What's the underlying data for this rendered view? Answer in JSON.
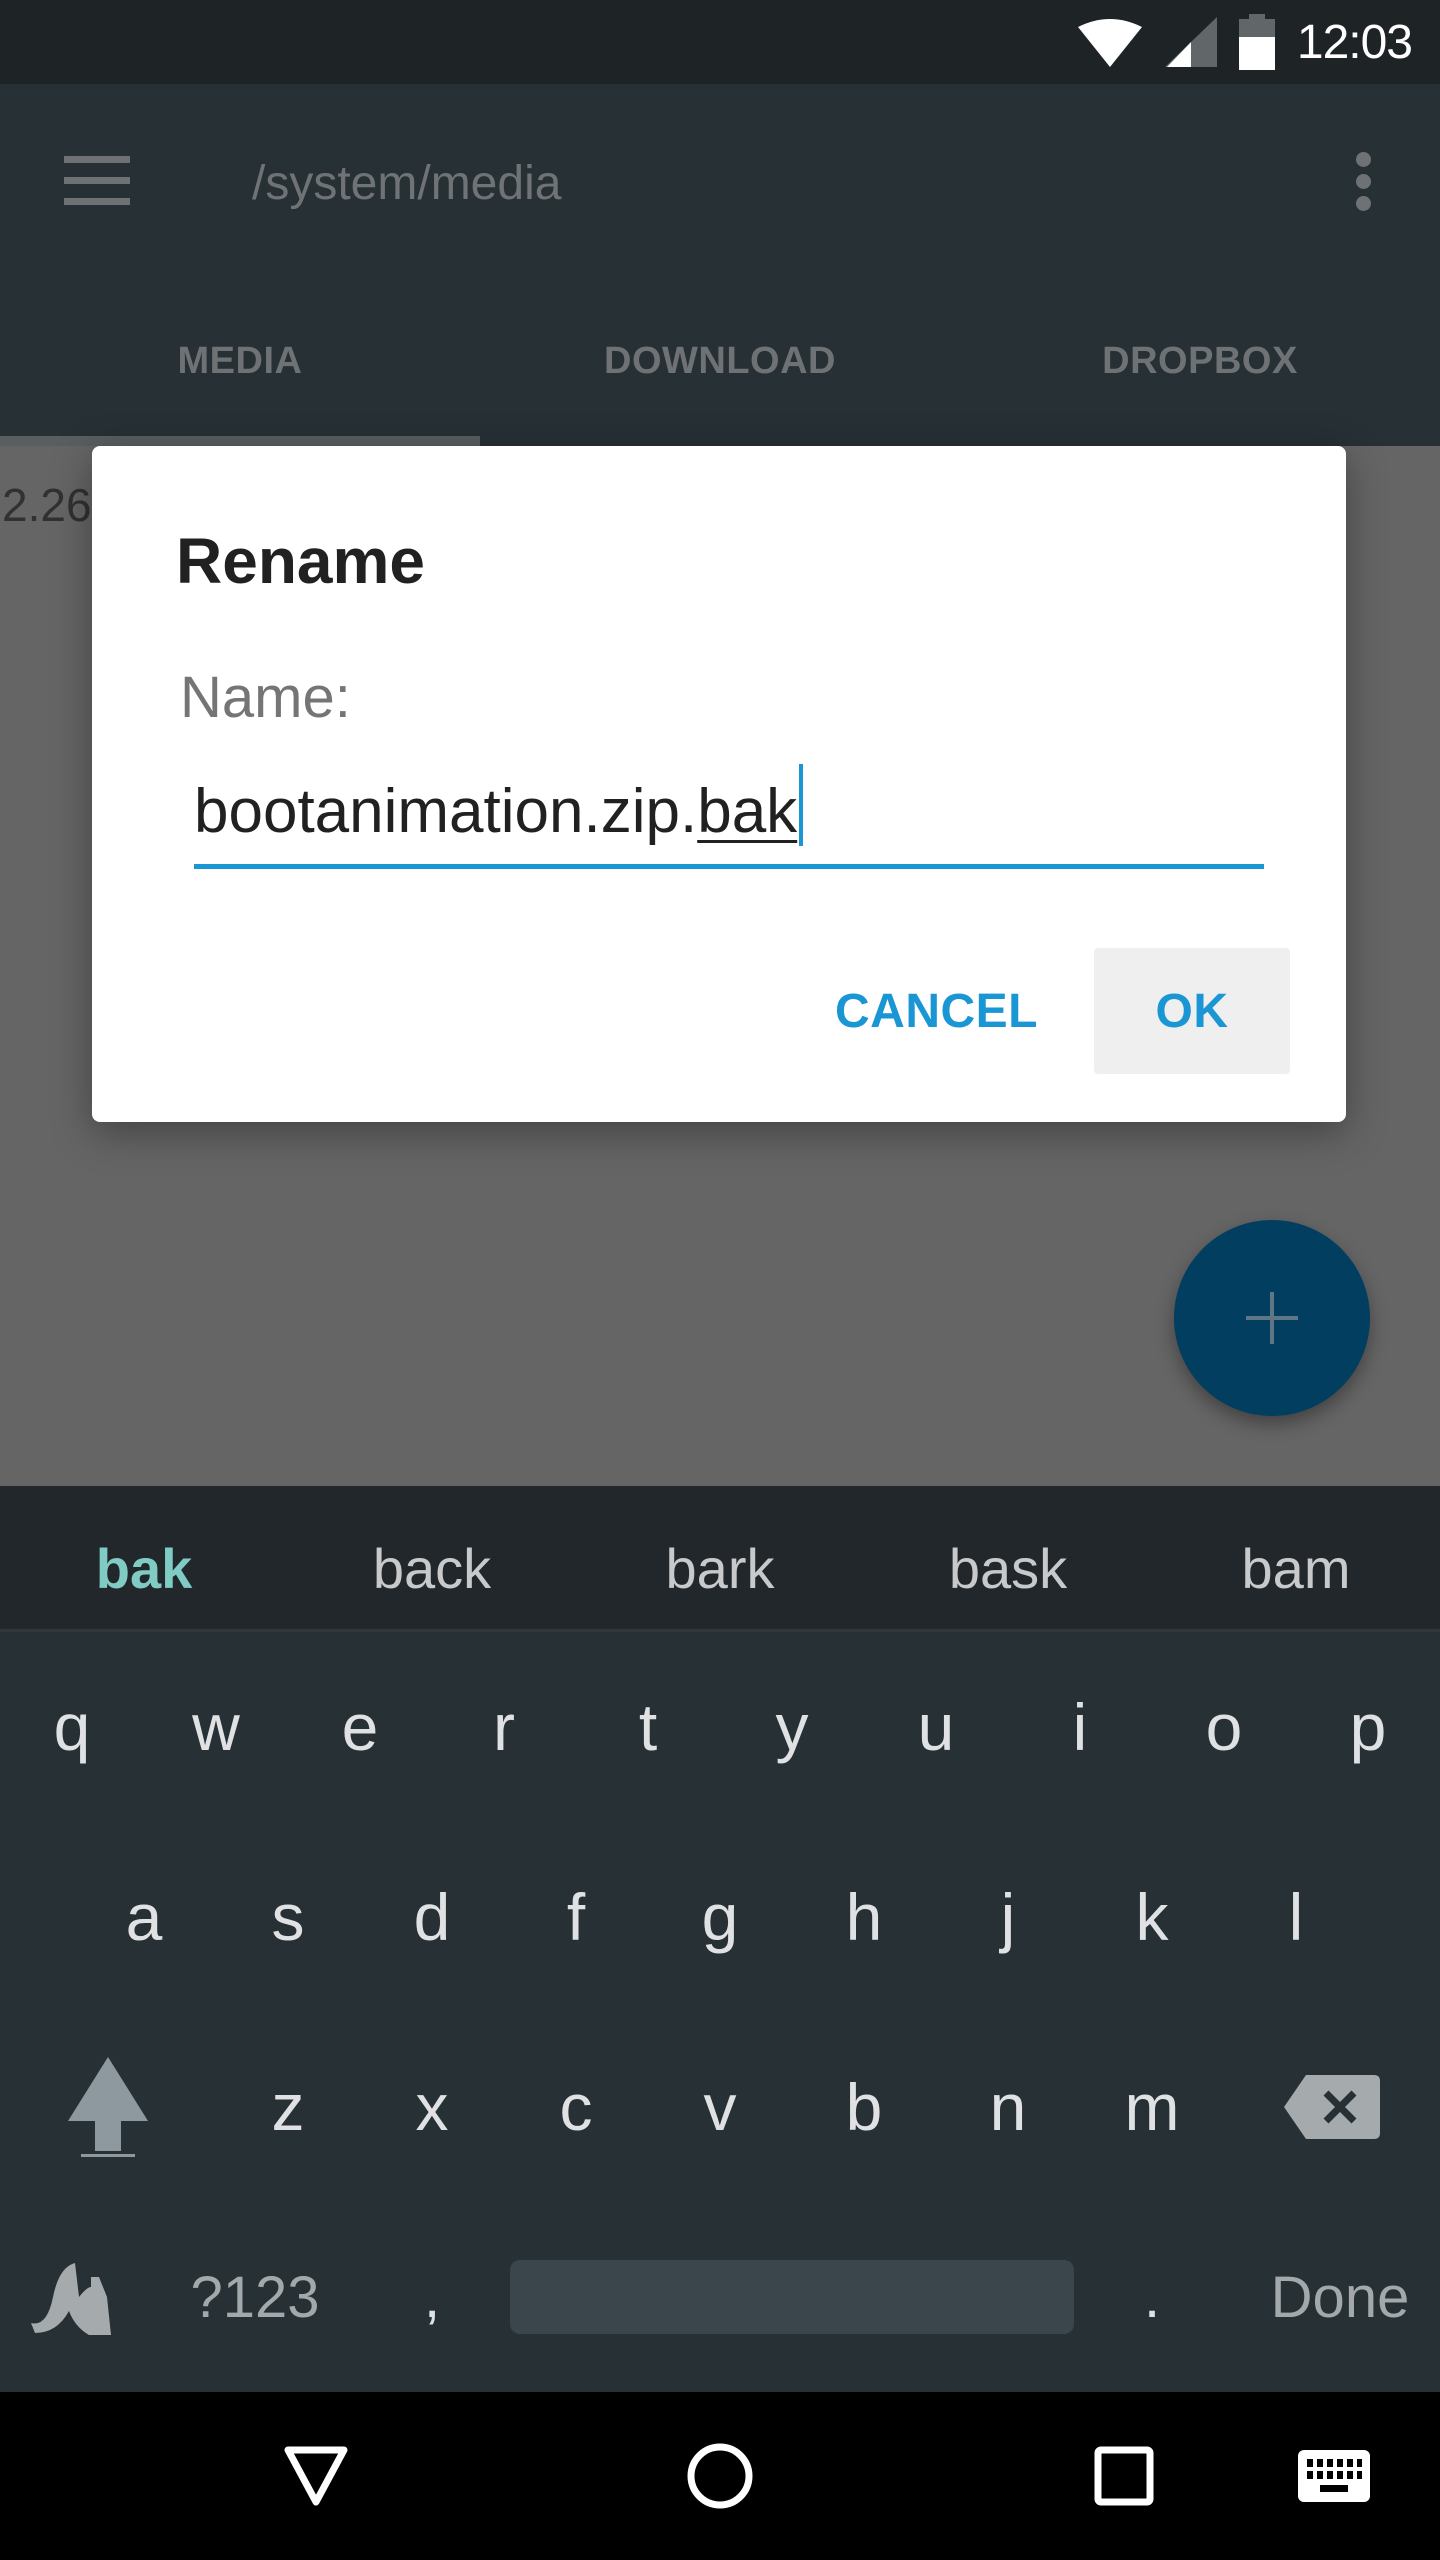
{
  "status_bar": {
    "time": "12:03",
    "icons": [
      "wifi-icon",
      "cell-signal-icon",
      "battery-icon"
    ]
  },
  "app_bar": {
    "menu_icon": "hamburger-menu-icon",
    "path": "/system/media",
    "overflow_icon": "more-vert-icon"
  },
  "tabs": [
    {
      "label": "MEDIA",
      "selected": true
    },
    {
      "label": "DOWNLOAD",
      "selected": false
    },
    {
      "label": "DROPBOX",
      "selected": false
    }
  ],
  "background_content": {
    "partial_text": "2.26"
  },
  "fab": {
    "icon": "plus-icon",
    "color": "#023e5f"
  },
  "dialog": {
    "title": "Rename",
    "field_label": "Name:",
    "field_value_prefix": "bootanimation.zip.",
    "field_value_composing": "bak",
    "cancel_label": "CANCEL",
    "ok_label": "OK",
    "accent_color": "#1a96d4"
  },
  "keyboard": {
    "suggestions": [
      {
        "text": "bak",
        "active": true
      },
      {
        "text": "back",
        "active": false
      },
      {
        "text": "bark",
        "active": false
      },
      {
        "text": "bask",
        "active": false
      },
      {
        "text": "bam",
        "active": false
      }
    ],
    "row1": [
      "q",
      "w",
      "e",
      "r",
      "t",
      "y",
      "u",
      "i",
      "o",
      "p"
    ],
    "row2": [
      "a",
      "s",
      "d",
      "f",
      "g",
      "h",
      "j",
      "k",
      "l"
    ],
    "row3": [
      "z",
      "x",
      "c",
      "v",
      "b",
      "n",
      "m"
    ],
    "shift_icon": "shift-arrow-icon",
    "backspace_icon": "backspace-icon",
    "gesture_icon": "gesture-typing-icon",
    "symbols_label": "?123",
    "comma_label": ",",
    "period_label": ".",
    "done_label": "Done"
  },
  "nav_bar": {
    "icons": [
      "back-triangle-icon",
      "home-circle-icon",
      "recents-square-icon",
      "keyboard-switch-icon"
    ]
  }
}
